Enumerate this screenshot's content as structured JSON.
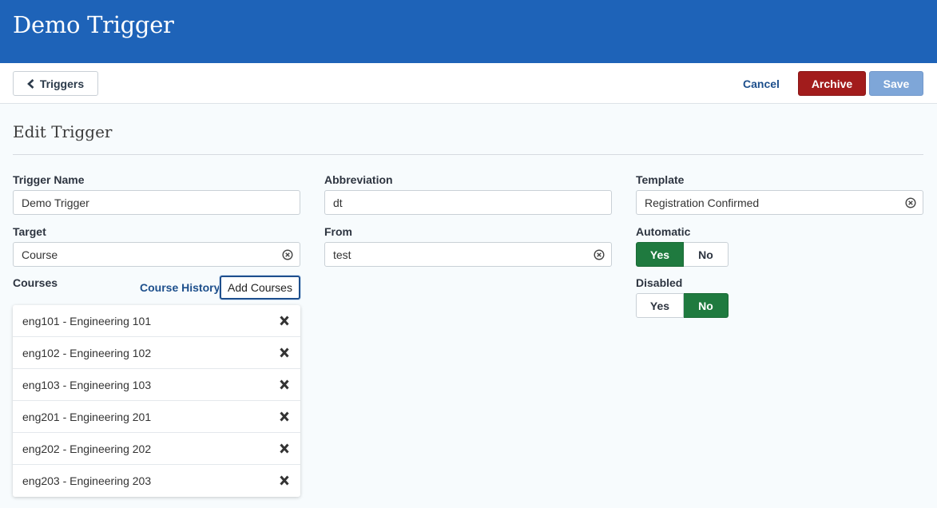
{
  "header": {
    "title": "Demo Trigger"
  },
  "toolbar": {
    "back_label": "Triggers",
    "cancel_label": "Cancel",
    "archive_label": "Archive",
    "save_label": "Save"
  },
  "section": {
    "title": "Edit Trigger"
  },
  "fields": {
    "trigger_name": {
      "label": "Trigger Name",
      "value": "Demo Trigger"
    },
    "abbreviation": {
      "label": "Abbreviation",
      "value": "dt"
    },
    "template": {
      "label": "Template",
      "value": "Registration Confirmed"
    },
    "target": {
      "label": "Target",
      "value": "Course"
    },
    "from": {
      "label": "From",
      "value": "test"
    },
    "automatic": {
      "label": "Automatic",
      "yes": "Yes",
      "no": "No",
      "selected": "Yes"
    },
    "disabled": {
      "label": "Disabled",
      "yes": "Yes",
      "no": "No",
      "selected": "No"
    }
  },
  "courses": {
    "label": "Courses",
    "history_label": "Course History",
    "add_label": "Add Courses",
    "items": [
      "eng101 - Engineering 101",
      "eng102 - Engineering 102",
      "eng103 - Engineering 103",
      "eng201 - Engineering 201",
      "eng202 - Engineering 202",
      "eng203 - Engineering 203"
    ]
  },
  "colors": {
    "header": "#1e63b8",
    "archive": "#a21c1c",
    "save": "#7ea6d8",
    "toggle_active": "#1f7a3f",
    "link": "#1d4f8c"
  }
}
